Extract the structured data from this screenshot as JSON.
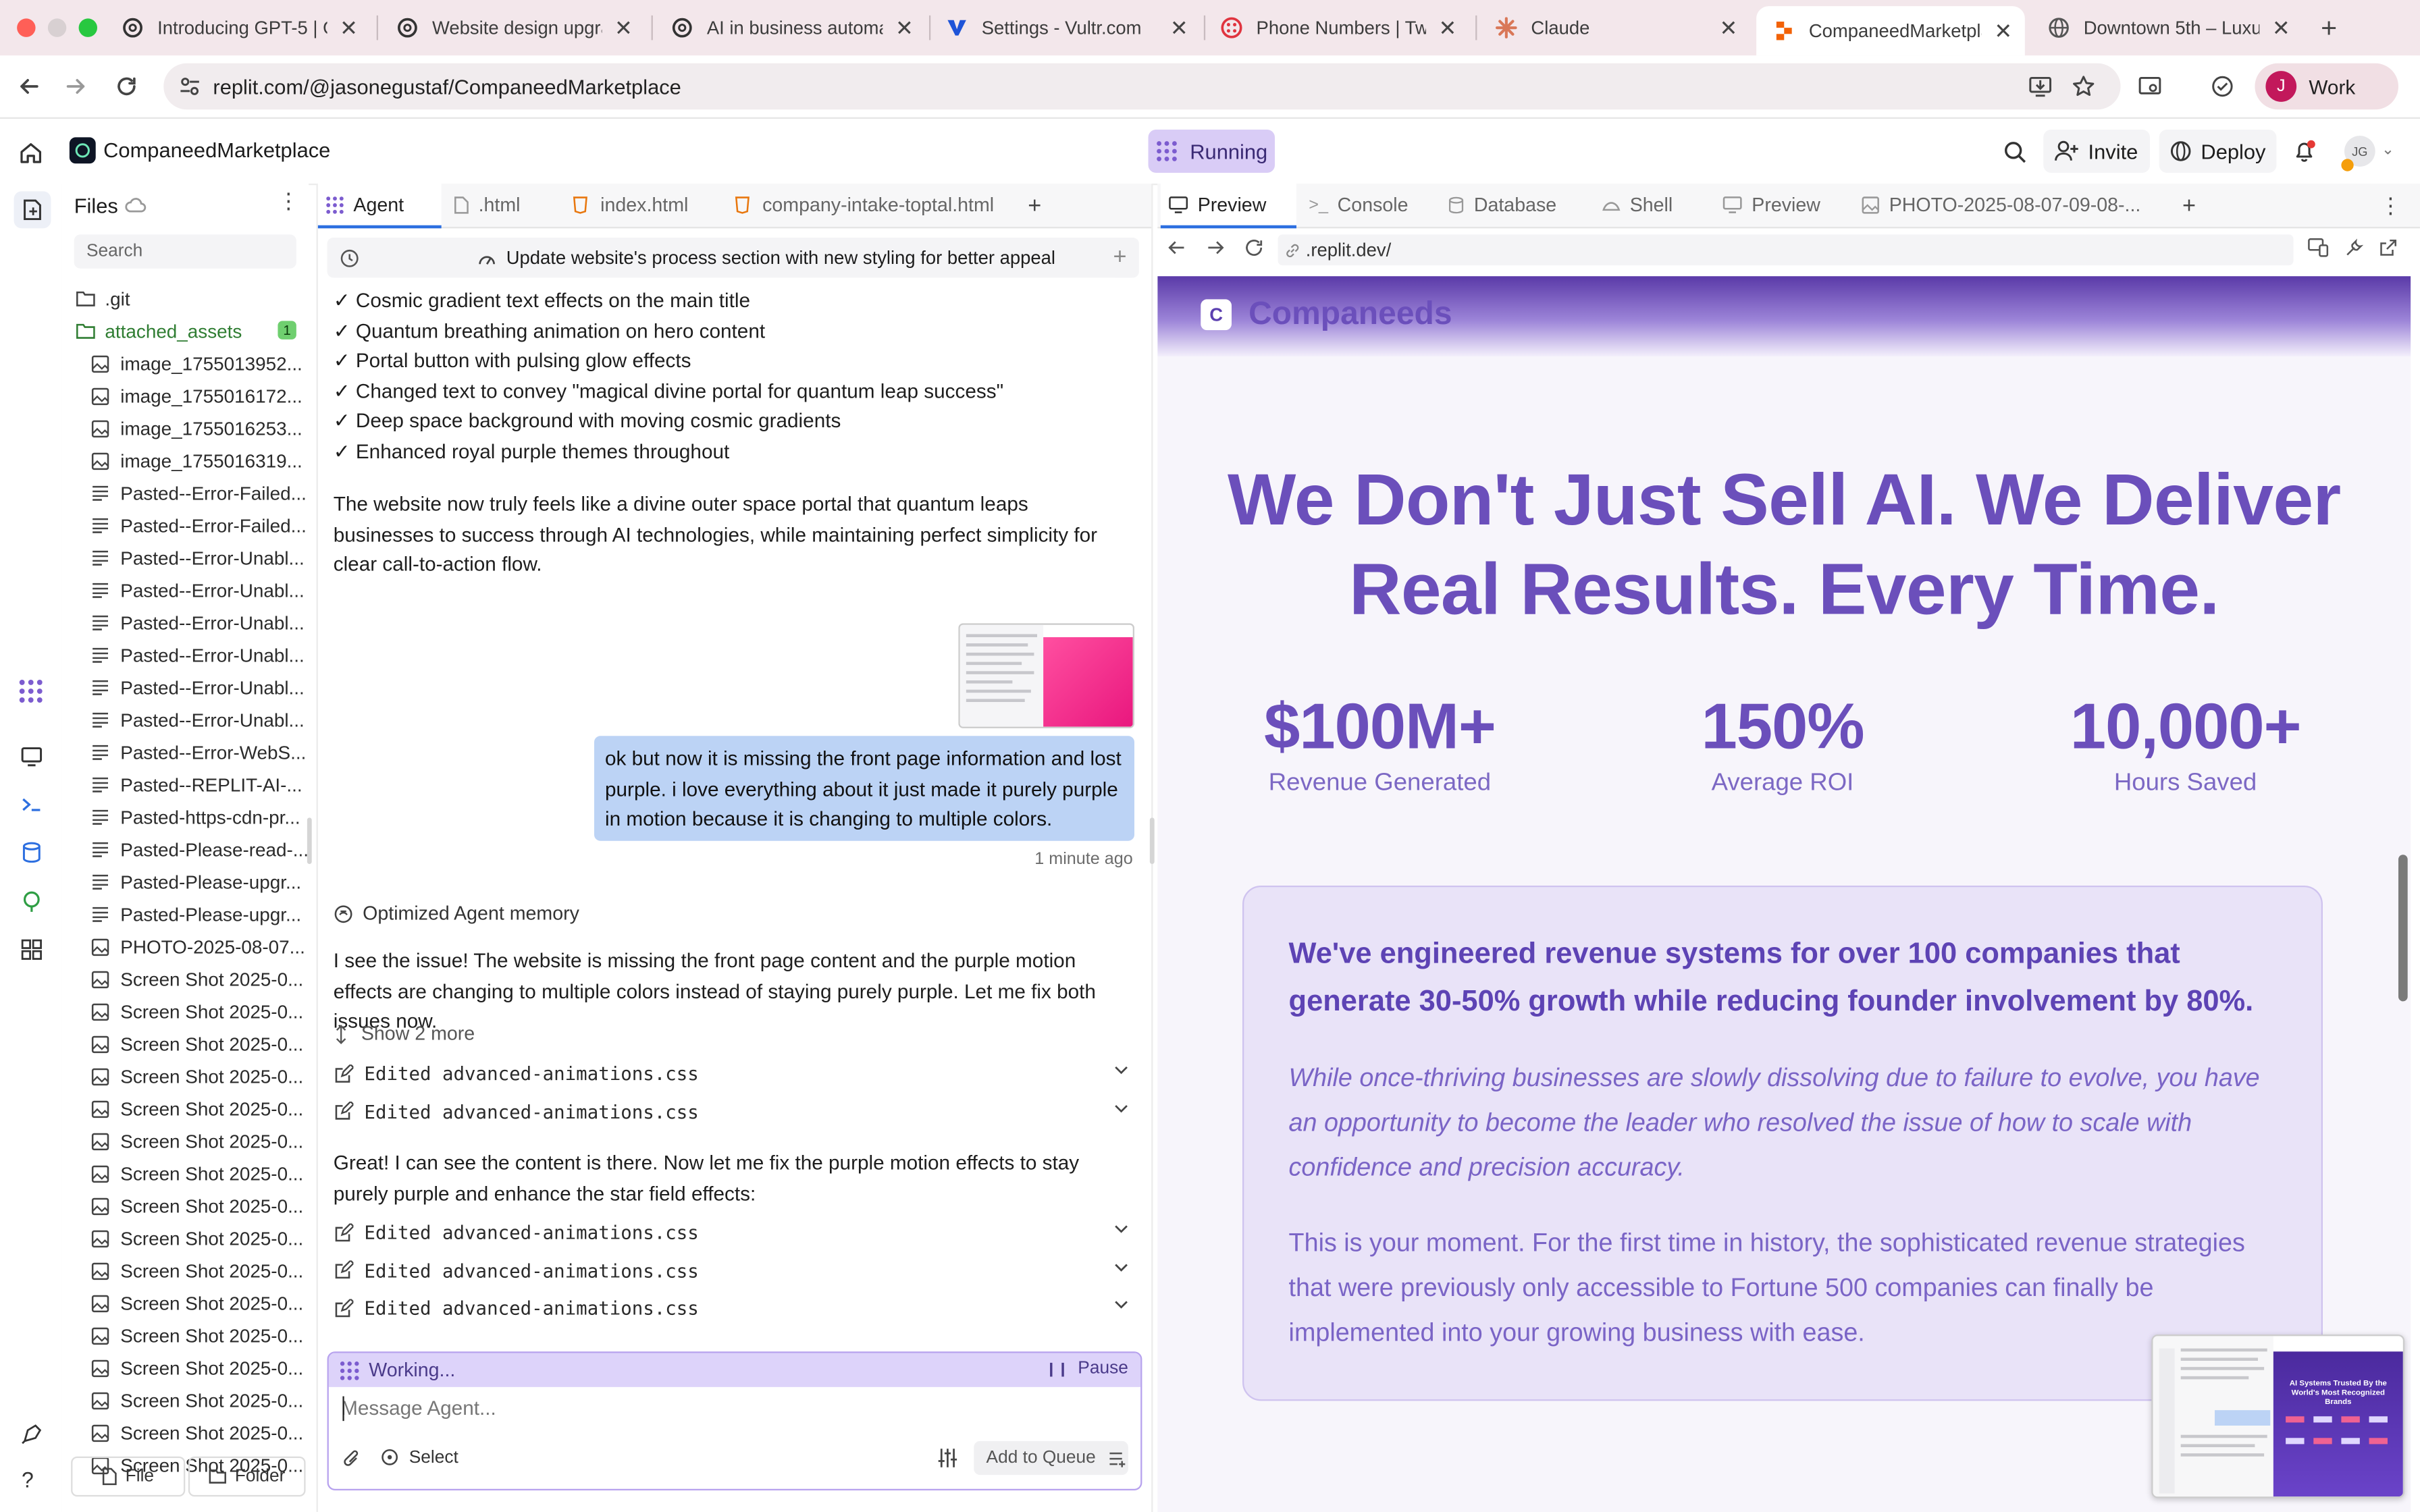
{
  "browser": {
    "tabs": [
      {
        "label": "Introducing GPT-5 | Op",
        "icon": "openai-icon"
      },
      {
        "label": "Website design upgrad",
        "icon": "openai-icon"
      },
      {
        "label": "AI in business automati",
        "icon": "openai-icon"
      },
      {
        "label": "Settings - Vultr.com",
        "icon": "vultr-icon"
      },
      {
        "label": "Phone Numbers | Twilio",
        "icon": "twilio-icon"
      },
      {
        "label": "Claude",
        "icon": "claude-icon"
      },
      {
        "label": "CompaneedMarketplac",
        "icon": "replit-icon",
        "active": true
      },
      {
        "label": "Downtown 5th – Luxury",
        "icon": "globe-icon"
      }
    ],
    "url": "replit.com/@jasonegustaf/CompaneedMarketplace",
    "profile_label": "Work",
    "profile_initial": "J"
  },
  "replit_header": {
    "project_name": "CompaneedMarketplace",
    "status": "Running",
    "invite_label": "Invite",
    "deploy_label": "Deploy",
    "avatar_initials": "JG"
  },
  "files": {
    "title": "Files",
    "search_placeholder": "Search",
    "badge": "1",
    "items": [
      {
        "name": ".git",
        "type": "folder"
      },
      {
        "name": "attached_assets",
        "type": "folder-open"
      },
      {
        "name": "image_1755013952...",
        "type": "image"
      },
      {
        "name": "image_1755016172...",
        "type": "image"
      },
      {
        "name": "image_1755016253...",
        "type": "image"
      },
      {
        "name": "image_1755016319...",
        "type": "image"
      },
      {
        "name": "Pasted--Error-Failed...",
        "type": "text"
      },
      {
        "name": "Pasted--Error-Failed...",
        "type": "text"
      },
      {
        "name": "Pasted--Error-Unabl...",
        "type": "text"
      },
      {
        "name": "Pasted--Error-Unabl...",
        "type": "text"
      },
      {
        "name": "Pasted--Error-Unabl...",
        "type": "text"
      },
      {
        "name": "Pasted--Error-Unabl...",
        "type": "text"
      },
      {
        "name": "Pasted--Error-Unabl...",
        "type": "text"
      },
      {
        "name": "Pasted--Error-Unabl...",
        "type": "text"
      },
      {
        "name": "Pasted--Error-WebS...",
        "type": "text"
      },
      {
        "name": "Pasted--REPLIT-AI-...",
        "type": "text"
      },
      {
        "name": "Pasted-https-cdn-pr...",
        "type": "text"
      },
      {
        "name": "Pasted-Please-read-...",
        "type": "text"
      },
      {
        "name": "Pasted-Please-upgr...",
        "type": "text"
      },
      {
        "name": "Pasted-Please-upgr...",
        "type": "text"
      },
      {
        "name": "PHOTO-2025-08-07...",
        "type": "image"
      },
      {
        "name": "Screen Shot 2025-0...",
        "type": "image"
      },
      {
        "name": "Screen Shot 2025-0...",
        "type": "image"
      },
      {
        "name": "Screen Shot 2025-0...",
        "type": "image"
      },
      {
        "name": "Screen Shot 2025-0...",
        "type": "image"
      },
      {
        "name": "Screen Shot 2025-0...",
        "type": "image"
      },
      {
        "name": "Screen Shot 2025-0...",
        "type": "image"
      },
      {
        "name": "Screen Shot 2025-0...",
        "type": "image"
      },
      {
        "name": "Screen Shot 2025-0...",
        "type": "image"
      },
      {
        "name": "Screen Shot 2025-0...",
        "type": "image"
      },
      {
        "name": "Screen Shot 2025-0...",
        "type": "image"
      },
      {
        "name": "Screen Shot 2025-0...",
        "type": "image"
      },
      {
        "name": "Screen Shot 2025-0...",
        "type": "image"
      },
      {
        "name": "Screen Shot 2025-0...",
        "type": "image"
      },
      {
        "name": "Screen Shot 2025-0...",
        "type": "image"
      },
      {
        "name": "Screen Shot 2025-0...",
        "type": "image"
      },
      {
        "name": "Screen Shot 2025-0...",
        "type": "image"
      }
    ],
    "new_file_label": "File",
    "new_folder_label": "Folder"
  },
  "agent_panel": {
    "tabs": [
      {
        "label": "Agent",
        "active": true
      },
      {
        "label": ".html"
      },
      {
        "label": "index.html"
      },
      {
        "label": "company-intake-toptal.html"
      }
    ],
    "thread_title": "Update website's process section with new styling for better appeal",
    "checklist": [
      "✓ Cosmic gradient text effects on the main title",
      "✓ Quantum breathing animation on hero content",
      "✓ Portal button with pulsing glow effects",
      "✓ Changed text to convey \"magical divine portal for quantum leap success\"",
      "✓ Deep space background with moving cosmic gradients",
      "✓ Enhanced royal purple themes throughout"
    ],
    "summary": "The website now truly feels like a divine outer space portal that quantum leaps businesses to success through AI technologies, while maintaining perfect simplicity for clear call-to-action flow.",
    "user_message": "ok but now it is missing the front page information and lost purple. i love everything about it just made it purely purple in motion because it is changing to multiple colors.",
    "user_time": "1 minute ago",
    "memory_label": "Optimized Agent memory",
    "reply1": "I see the issue! The website is missing the front page content and the purple motion effects are changing to multiple colors instead of staying purely purple. Let me fix both issues now.",
    "show_more": "Show 2 more",
    "edits_a": [
      "Edited advanced-animations.css",
      "Edited advanced-animations.css"
    ],
    "reply2": "Great! I can see the content is there. Now let me fix the purple motion effects to stay purely purple and enhance the star field effects:",
    "edits_b": [
      "Edited advanced-animations.css",
      "Edited advanced-animations.css",
      "Edited advanced-animations.css"
    ],
    "working_label": "Working...",
    "pause_label": "Pause",
    "input_placeholder": "Message Agent...",
    "select_label": "Select",
    "queue_label": "Add to Queue"
  },
  "right_panel": {
    "tabs": [
      {
        "label": "Preview",
        "active": true
      },
      {
        "label": "Console"
      },
      {
        "label": "Database"
      },
      {
        "label": "Shell"
      },
      {
        "label": "Preview"
      },
      {
        "label": "PHOTO-2025-08-07-09-08-..."
      }
    ],
    "url": ".replit.dev/"
  },
  "site": {
    "logo_letter": "C",
    "brand": "Companeeds",
    "headline_line1": "We Don't Just Sell AI. We Deliver",
    "headline_line2": "Real Results. Every Time.",
    "stats": [
      {
        "value": "$100M+",
        "label": "Revenue Generated"
      },
      {
        "value": "150%",
        "label": "Average ROI"
      },
      {
        "value": "10,000+",
        "label": "Hours Saved"
      }
    ],
    "card_lead": "We've engineered revenue systems for over 100 companies that generate 30-50% growth while reducing founder involvement by 80%.",
    "card_italic": "While once-thriving businesses are slowly dissolving due to failure to evolve, you have an opportunity to become the leader who resolved the issue of how to scale with confidence and precision accuracy.",
    "card_body": "This is your moment. For the first time in history, the sophisticated revenue strategies that were previously only accessible to Fortune 500 companies can finally be implemented into your growing business with ease.",
    "thumb_text": "AI Systems Trusted By the World's Most Recognized Brands"
  },
  "colors": {
    "accent_purple": "#6b4fbb",
    "running_bg": "#d9ccf6",
    "user_bubble": "#bcd3f5",
    "tab_strip": "#f3e7eb"
  }
}
